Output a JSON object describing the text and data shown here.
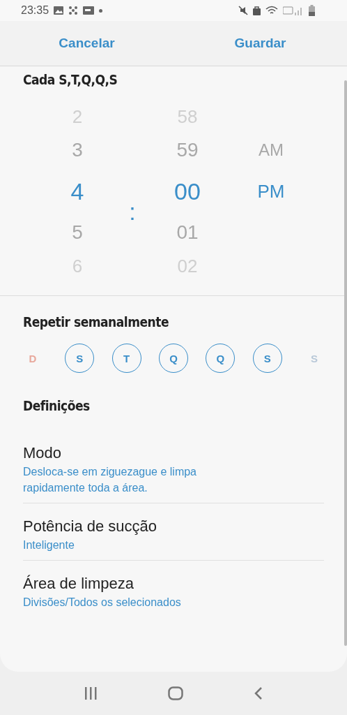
{
  "status_bar": {
    "time": "23:35"
  },
  "header": {
    "cancel": "Cancelar",
    "save": "Guardar"
  },
  "schedule_title": "Cada S,T,Q,Q,S",
  "time_picker": {
    "separator": ":",
    "hours": [
      {
        "label": "2",
        "selected": false
      },
      {
        "label": "3",
        "selected": false
      },
      {
        "label": "4",
        "selected": true
      },
      {
        "label": "5",
        "selected": false
      },
      {
        "label": "6",
        "selected": false
      }
    ],
    "minutes": [
      {
        "label": "58",
        "selected": false
      },
      {
        "label": "59",
        "selected": false
      },
      {
        "label": "00",
        "selected": true
      },
      {
        "label": "01",
        "selected": false
      },
      {
        "label": "02",
        "selected": false
      }
    ],
    "periods": [
      {
        "label": "AM",
        "selected": false
      },
      {
        "label": "PM",
        "selected": true
      }
    ]
  },
  "repeat": {
    "title": "Repetir semanalmente",
    "days": [
      {
        "label": "D",
        "selected": false,
        "color": "#e8a89c"
      },
      {
        "label": "S",
        "selected": true,
        "color": "#3a8ec9"
      },
      {
        "label": "T",
        "selected": true,
        "color": "#3a8ec9"
      },
      {
        "label": "Q",
        "selected": true,
        "color": "#3a8ec9"
      },
      {
        "label": "Q",
        "selected": true,
        "color": "#3a8ec9"
      },
      {
        "label": "S",
        "selected": true,
        "color": "#3a8ec9"
      },
      {
        "label": "S",
        "selected": false,
        "color": "#b8c8d8"
      }
    ]
  },
  "settings": {
    "title": "Definições",
    "items": [
      {
        "label": "Modo",
        "value": "Desloca-se em ziguezague e limpa rapidamente toda a área."
      },
      {
        "label": "Potência de sucção",
        "value": "Inteligente"
      },
      {
        "label": "Área de limpeza",
        "value": "Divisões/Todos os selecionados"
      }
    ]
  }
}
